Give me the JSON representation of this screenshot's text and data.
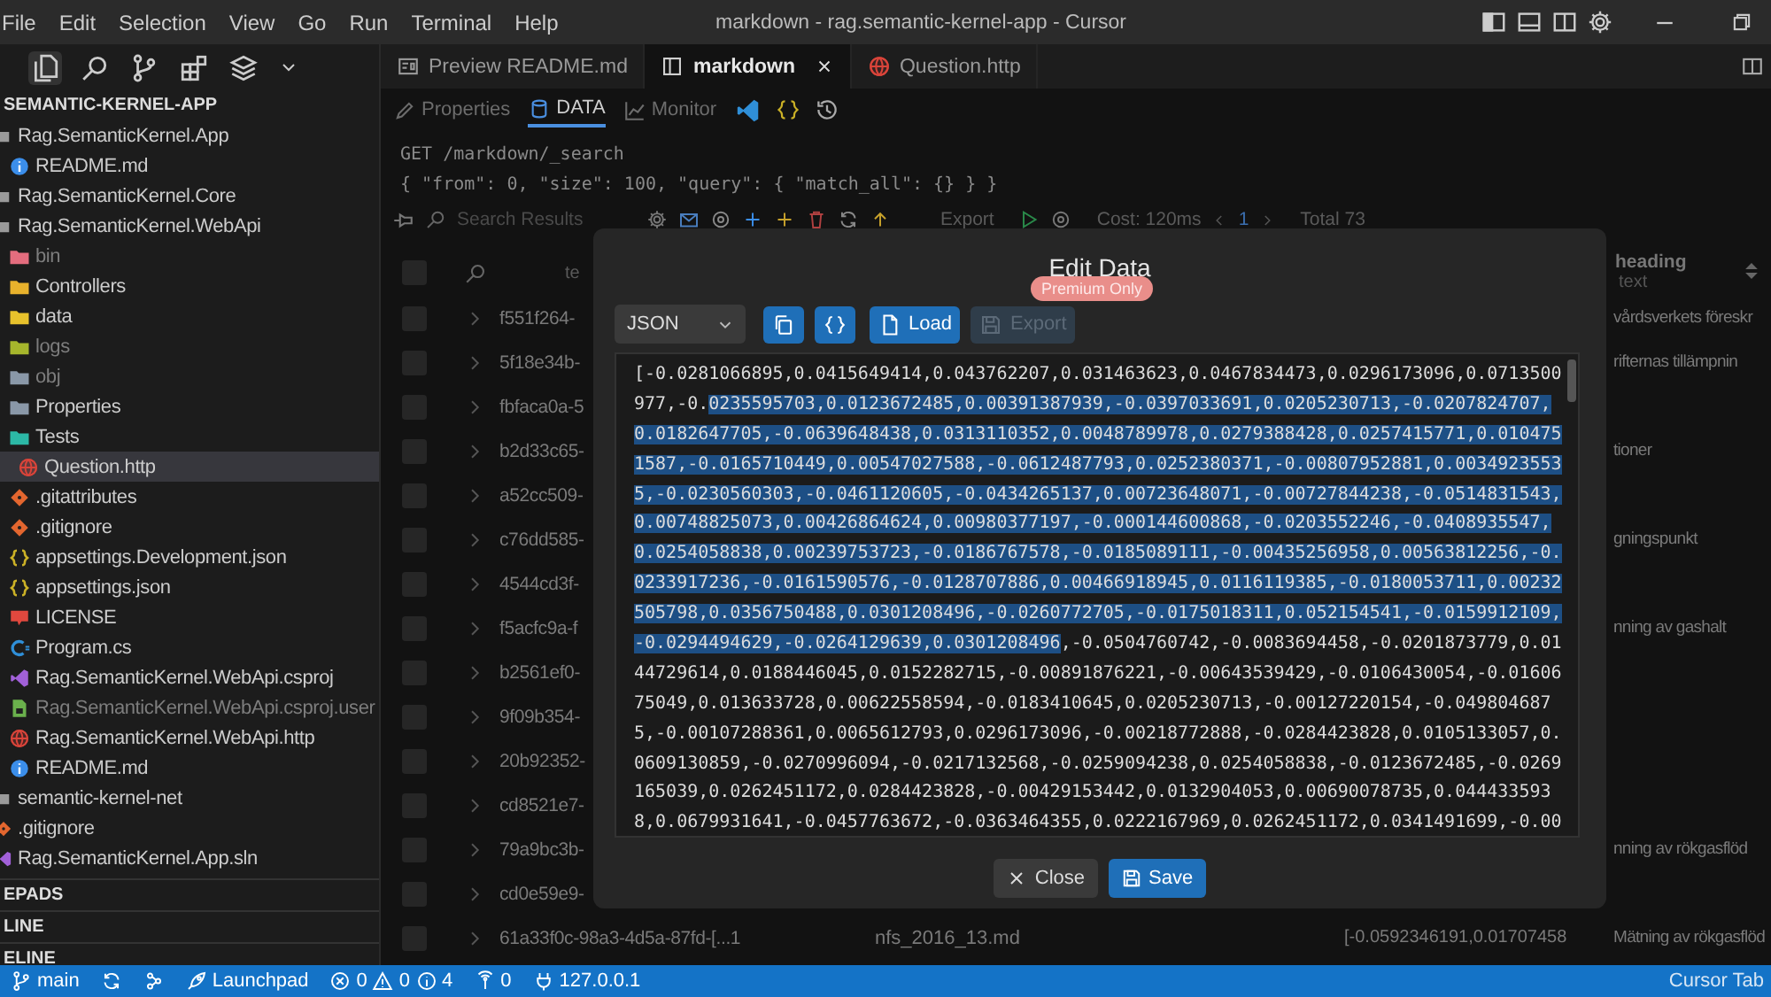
{
  "window": {
    "title": "markdown - rag.semantic-kernel-app - Cursor"
  },
  "menu": [
    "File",
    "Edit",
    "Selection",
    "View",
    "Go",
    "Run",
    "Terminal",
    "Help"
  ],
  "activity_bar": [
    {
      "kind": "explorer",
      "selected": true
    },
    {
      "kind": "search",
      "selected": false
    },
    {
      "kind": "branch",
      "selected": false
    },
    {
      "kind": "extensions",
      "selected": false
    },
    {
      "kind": "layers",
      "selected": false
    },
    {
      "kind": "more",
      "selected": false
    }
  ],
  "explorer": {
    "title": "SEMANTIC-KERNEL-APP",
    "items": [
      {
        "label": "Rag.SemanticKernel.App",
        "kind": "project",
        "dimmed": false,
        "selected": false,
        "children": [
          {
            "label": "README.md",
            "kind": "info",
            "dimmed": false,
            "selected": false
          }
        ]
      },
      {
        "label": "Rag.SemanticKernel.Core",
        "kind": "project",
        "dimmed": false,
        "selected": false
      },
      {
        "label": "Rag.SemanticKernel.WebApi",
        "kind": "project",
        "dimmed": false,
        "selected": false,
        "children": [
          {
            "label": "bin",
            "kind": "folder",
            "color": "#e46d7e",
            "dimmed": true,
            "selected": false
          },
          {
            "label": "Controllers",
            "kind": "folder",
            "color": "#e8b22c",
            "dimmed": false,
            "selected": false
          },
          {
            "label": "data",
            "kind": "folder",
            "color": "#e8c22c",
            "dimmed": false,
            "selected": false
          },
          {
            "label": "logs",
            "kind": "folder",
            "color": "#a6b62c",
            "dimmed": true,
            "selected": false
          },
          {
            "label": "obj",
            "kind": "folder",
            "color": "#8a98a8",
            "dimmed": true,
            "selected": false
          },
          {
            "label": "Properties",
            "kind": "folder",
            "color": "#8a98a8",
            "dimmed": false,
            "selected": false
          },
          {
            "label": "Tests",
            "kind": "folder",
            "color": "#2cb8a6",
            "dimmed": false,
            "selected": false,
            "children": [
              {
                "label": "Question.http",
                "kind": "http",
                "dimmed": false,
                "selected": true
              }
            ]
          },
          {
            "label": ".gitattributes",
            "kind": "git",
            "dimmed": false,
            "selected": false
          },
          {
            "label": ".gitignore",
            "kind": "git",
            "dimmed": false,
            "selected": false
          },
          {
            "label": "appsettings.Development.json",
            "kind": "json",
            "dimmed": false,
            "selected": false
          },
          {
            "label": "appsettings.json",
            "kind": "json",
            "dimmed": false,
            "selected": false
          },
          {
            "label": "LICENSE",
            "kind": "license",
            "dimmed": false,
            "selected": false
          },
          {
            "label": "Program.cs",
            "kind": "csharp",
            "dimmed": false,
            "selected": false
          },
          {
            "label": "Rag.SemanticKernel.WebApi.csproj",
            "kind": "vsproj",
            "dimmed": false,
            "selected": false
          },
          {
            "label": "Rag.SemanticKernel.WebApi.csproj.user",
            "kind": "userfile",
            "dimmed": true,
            "selected": false
          },
          {
            "label": "Rag.SemanticKernel.WebApi.http",
            "kind": "http",
            "dimmed": false,
            "selected": false
          },
          {
            "label": "README.md",
            "kind": "info",
            "dimmed": false,
            "selected": false
          }
        ]
      },
      {
        "label": "semantic-kernel-net",
        "kind": "project",
        "dimmed": false,
        "selected": false
      },
      {
        "label": ".gitignore",
        "kind": "git",
        "dimmed": false,
        "selected": false
      },
      {
        "label": "Rag.SemanticKernel.App.sln",
        "kind": "vsproj",
        "dimmed": false,
        "selected": false
      }
    ]
  },
  "panels": [
    {
      "label": "EPADS"
    },
    {
      "label": "LINE"
    },
    {
      "label": "ELINE"
    }
  ],
  "tabs": [
    {
      "label": "Preview README.md",
      "kind": "preview",
      "selected": false,
      "closable": false
    },
    {
      "label": "markdown",
      "kind": "table",
      "selected": true,
      "closable": true
    },
    {
      "label": "Question.http",
      "kind": "http",
      "selected": false,
      "closable": false
    }
  ],
  "view_tabs": [
    {
      "label": "Properties",
      "kind": "pencil",
      "selected": false
    },
    {
      "label": "DATA",
      "kind": "database",
      "selected": true
    },
    {
      "label": "Monitor",
      "kind": "chart",
      "selected": false
    }
  ],
  "query": {
    "lines": [
      "GET /markdown/_search",
      "{ \"from\": 0, \"size\": 100, \"query\": { \"match_all\": {} } }"
    ]
  },
  "results_toolbar": {
    "search_placeholder": "Search Results",
    "export": "Export",
    "cost": "Cost: 120ms",
    "page": "1",
    "total": "Total 73"
  },
  "table": {
    "all_checked": false,
    "columns": [
      {
        "label": "te"
      },
      {
        "label": "heading",
        "sublabel": "text"
      }
    ],
    "rows": [
      {
        "checked": false,
        "id": "f551f264-",
        "heading": "vårdsverkets föreskr"
      },
      {
        "checked": false,
        "id": "5f18e34b-",
        "heading": "rifternas tillämpnin"
      },
      {
        "checked": false,
        "id": "fbfaca0a-5"
      },
      {
        "checked": false,
        "id": "b2d33c65-",
        "heading": "tioner"
      },
      {
        "checked": false,
        "id": "a52cc509-"
      },
      {
        "checked": false,
        "id": "c76dd585-",
        "heading": "gningspunkt"
      },
      {
        "checked": false,
        "id": "4544cd3f-"
      },
      {
        "checked": false,
        "id": "f5acfc9a-f",
        "heading": "nning av gashalt"
      },
      {
        "checked": false,
        "id": "b2561ef0-"
      },
      {
        "checked": false,
        "id": "9f09b354-"
      },
      {
        "checked": false,
        "id": "20b92352-"
      },
      {
        "checked": false,
        "id": "cd8521e7-"
      },
      {
        "checked": false,
        "id": "79a9bc3b-",
        "heading": "nning av rökgasflöd"
      },
      {
        "checked": false,
        "id": "cd0e59e9-"
      },
      {
        "checked": false,
        "id": "61a33f0c-98a3-4d5a-87fd-[...1",
        "file": "nfs_2016_13.md",
        "vector": "[-0.0592346191,0.01707458",
        "heading": "Mätning av rökgasflöd"
      }
    ]
  },
  "dialog": {
    "title": "Edit Data",
    "badge": "Premium Only",
    "format": "JSON",
    "actions": [
      {
        "kind": "copy",
        "disabled": false
      },
      {
        "kind": "format",
        "disabled": false
      },
      {
        "kind": "load",
        "label": "Load",
        "disabled": false
      },
      {
        "kind": "export",
        "label": "Export",
        "disabled": true
      }
    ],
    "lines": [
      [
        {
          "text": "[-0.0281066895,0.0415649414,0.043762207,0.031463623,0.0467834473,0.0296173096,0.0713500",
          "selected": false
        }
      ],
      [
        {
          "text": "977,-0.",
          "selected": false
        },
        {
          "text": "0235595703,0.0123672485,0.00391387939,-0.0397033691,0.0205230713,-0.0207824707,",
          "selected": true
        }
      ],
      [
        {
          "text": "0.0182647705,-0.0639648438,0.0313110352,0.0048789978,0.0279388428,0.0257415771,0.010475",
          "selected": true
        }
      ],
      [
        {
          "text": "1587,-0.0165710449,0.00547027588,-0.0612487793,0.0252380371,-0.00807952881,0.0034923553",
          "selected": true
        }
      ],
      [
        {
          "text": "5,-0.0230560303,-0.0461120605,-0.0434265137,0.00723648071,-0.00727844238,-0.0514831543,",
          "selected": true
        }
      ],
      [
        {
          "text": "0.00748825073,0.00426864624,0.00980377197,-0.000144600868,-0.0203552246,-0.0408935547,",
          "selected": true
        }
      ],
      [
        {
          "text": "0.0254058838,0.00239753723,-0.0186767578,-0.0185089111,-0.00435256958,0.00563812256,-0.",
          "selected": true
        }
      ],
      [
        {
          "text": "0233917236,-0.0161590576,-0.0128707886,0.00466918945,0.0116119385,-0.0180053711,0.00232",
          "selected": true
        }
      ],
      [
        {
          "text": "505798,0.0356750488,0.0301208496,-0.0260772705,-0.0175018311,0.052154541,-0.0159912109,",
          "selected": true
        }
      ],
      [
        {
          "text": "-0.0294494629,-0.0264129639,0.0301208496",
          "selected": true
        },
        {
          "text": ",-0.0504760742,-0.0083694458,-0.0201873779,0.01",
          "selected": false
        }
      ],
      [
        {
          "text": "44729614,0.0188446045,0.0152282715,-0.00891876221,-0.00643539429,-0.0106430054,-0.01606",
          "selected": false
        }
      ],
      [
        {
          "text": "75049,0.013633728,0.00622558594,-0.0183410645,0.0205230713,-0.00127220154,-0.049804687",
          "selected": false
        }
      ],
      [
        {
          "text": "5,-0.00107288361,0.0065612793,0.0296173096,-0.00218772888,-0.0284423828,0.0105133057,0.",
          "selected": false
        }
      ],
      [
        {
          "text": "0609130859,-0.0270996094,-0.0217132568,-0.0259094238,0.0254058838,-0.0123672485,-0.0269",
          "selected": false
        }
      ],
      [
        {
          "text": "165039,0.0262451172,0.0284423828,-0.00429153442,0.0132904053,0.00690078735,0.044433593",
          "selected": false
        }
      ],
      [
        {
          "text": "8,0.0679931641,-0.0457763672,-0.0363464355,0.0222167969,0.0262451172,0.0341491699,-0.00",
          "selected": false
        }
      ]
    ],
    "buttons": [
      {
        "kind": "close",
        "label": "Close",
        "primary": false
      },
      {
        "kind": "save",
        "label": "Save",
        "primary": true
      }
    ]
  },
  "status_bar": {
    "items": [
      {
        "kind": "branch",
        "label": "main"
      },
      {
        "kind": "sync"
      },
      {
        "kind": "share"
      },
      {
        "kind": "launchpad",
        "label": "Launchpad"
      },
      {
        "kind": "problems",
        "errors": "0",
        "warnings": "0",
        "infos": "4"
      },
      {
        "kind": "ports",
        "label": "0"
      },
      {
        "kind": "server",
        "label": "127.0.0.1"
      }
    ],
    "right": "Cursor Tab"
  }
}
